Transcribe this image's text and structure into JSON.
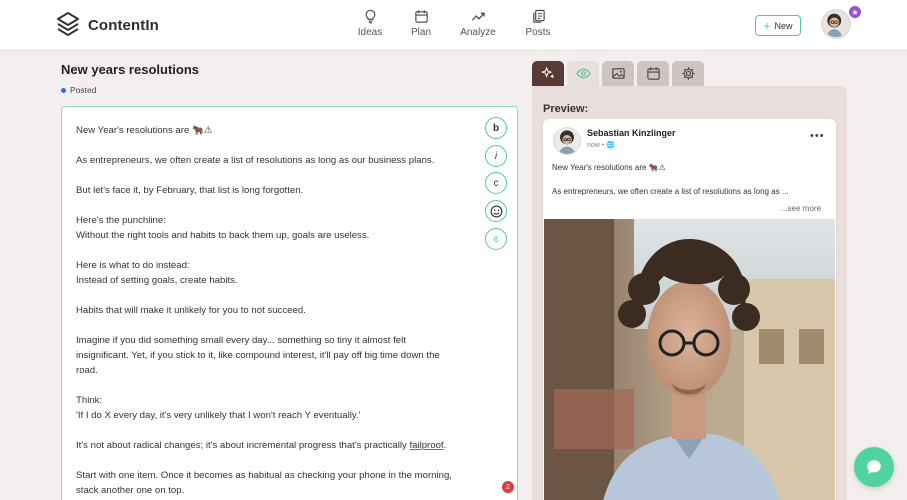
{
  "app": {
    "name": "ContentIn"
  },
  "nav": {
    "items": [
      {
        "label": "Ideas"
      },
      {
        "label": "Plan"
      },
      {
        "label": "Analyze"
      },
      {
        "label": "Posts"
      }
    ]
  },
  "header": {
    "new_label": "New"
  },
  "post": {
    "title": "New years resolutions",
    "status": "Posted"
  },
  "editor": {
    "lines": [
      "New Year's resolutions are 🐂⚠",
      "As entrepreneurs, we often create a list of resolutions as long as our business plans.",
      "But let's face it, by February, that list is long forgotten.",
      "Here's the punchline:",
      "Without the right tools and habits to back them up, goals are useless.",
      "Here is what to do instead:",
      "Instead of setting goals, create habits.",
      "Habits that will make it unlikely for you to not succeed.",
      "Imagine if you did something small every day... something so tiny it almost felt",
      "insignificant. Yet, if you stick to it, like compound interest, it'll pay off big time down the",
      "road.",
      "Think:",
      "'If I do X every day, it's very unlikely that I won't reach Y eventually.'",
      "It's not about radical changes; it's about incremental progress that's practically ",
      "failproof",
      ".",
      "Start with one item. Once it becomes as habitual as checking your phone in the morning,",
      "stack another one on top."
    ],
    "format": {
      "bold": "b",
      "italic": "i",
      "copy": "c",
      "count": "6"
    },
    "error_count": "2"
  },
  "preview": {
    "label": "Preview:",
    "author": "Sebastian Kinzlinger",
    "meta": "now • ",
    "line1": "New Year's resolutions are 🐂⚠",
    "line2": "As entrepreneurs, we often create a list of resolutions as long as ...",
    "see_more": "...see more"
  },
  "colors": {
    "accent": "#4fc9a0",
    "tab_active": "#5a3a35",
    "status_dot": "#2b6fe0",
    "error": "#e03d3d",
    "chat": "#4fd39f"
  }
}
